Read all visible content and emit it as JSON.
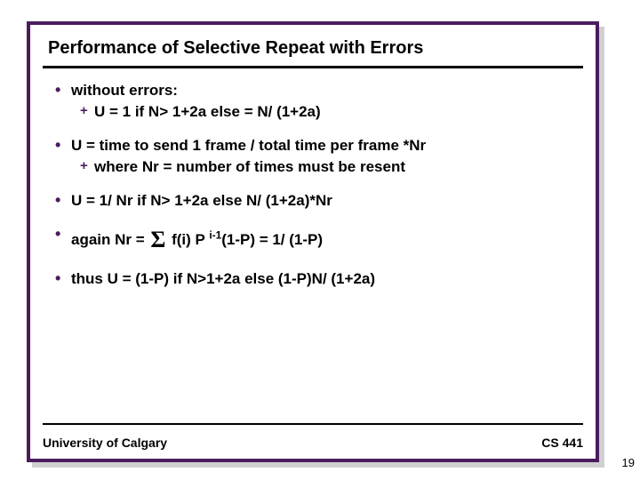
{
  "title": "Performance of Selective Repeat with Errors",
  "b1": "without errors:",
  "s1": "U = 1 if N> 1+2a  else = N/ (1+2a)",
  "b2": "U = time to send 1 frame / total time per frame *Nr",
  "s2": "where Nr = number of times must be resent",
  "b3": "U = 1/ Nr if N> 1+2a  else N/ (1+2a)*Nr",
  "b4a": "again Nr = ",
  "b4b": " f(i) P ",
  "b4sup": "i-1",
  "b4c": "(1-P) = 1/ (1-P)",
  "b5": "thus U = (1-P) if N>1+2a  else (1-P)N/ (1+2a)",
  "footer_left": "University of Calgary",
  "footer_right": "CS 441",
  "page_number": "19"
}
